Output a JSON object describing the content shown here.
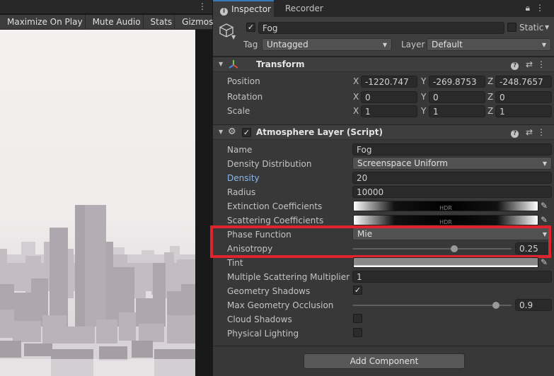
{
  "game_view": {
    "toolbar": {
      "maximize_on_play": "Maximize On Play",
      "mute_audio": "Mute Audio",
      "stats": "Stats",
      "gizmos": "Gizmos"
    }
  },
  "inspector": {
    "tabs": [
      {
        "label": "Inspector",
        "icon": "info-icon"
      },
      {
        "label": "Recorder"
      }
    ],
    "object": {
      "name": "Fog",
      "active": true,
      "static_label": "Static",
      "tag_label": "Tag",
      "tag_value": "Untagged",
      "layer_label": "Layer",
      "layer_value": "Default"
    },
    "transform": {
      "title": "Transform",
      "rows": [
        {
          "label": "Position",
          "x": "-1220.747",
          "y": "-269.8753",
          "z": "-248.7657"
        },
        {
          "label": "Rotation",
          "x": "0",
          "y": "0",
          "z": "0"
        },
        {
          "label": "Scale",
          "x": "1",
          "y": "1",
          "z": "1"
        }
      ],
      "axis_x": "X",
      "axis_y": "Y",
      "axis_z": "Z"
    },
    "atmosphere": {
      "title": "Atmosphere Layer (Script)",
      "enabled": true,
      "name_label": "Name",
      "name_value": "Fog",
      "density_distribution_label": "Density Distribution",
      "density_distribution_value": "Screenspace Uniform",
      "density_label": "Density",
      "density_value": "20",
      "radius_label": "Radius",
      "radius_value": "10000",
      "extinction_label": "Extinction Coefficients",
      "scattering_label": "Scattering Coefficients",
      "hdr_tag": "HDR",
      "phase_function_label": "Phase Function",
      "phase_function_value": "Mie",
      "anisotropy_label": "Anisotropy",
      "anisotropy_value": "0.25",
      "anisotropy_fraction": 0.64,
      "tint_label": "Tint",
      "multiple_scattering_label": "Multiple Scattering Multiplier",
      "multiple_scattering_value": "1",
      "geometry_shadows_label": "Geometry Shadows",
      "geometry_shadows": true,
      "max_geometry_occlusion_label": "Max Geometry Occlusion",
      "max_geometry_occlusion_value": "0.9",
      "max_geometry_occlusion_fraction": 0.9,
      "cloud_shadows_label": "Cloud Shadows",
      "cloud_shadows": false,
      "physical_lighting_label": "Physical Lighting",
      "physical_lighting": false
    },
    "add_component": "Add Component"
  },
  "colors": {
    "highlight": "#e0232f",
    "density_label": "#8bb8ef",
    "accent_tab": "#3a79bb"
  }
}
